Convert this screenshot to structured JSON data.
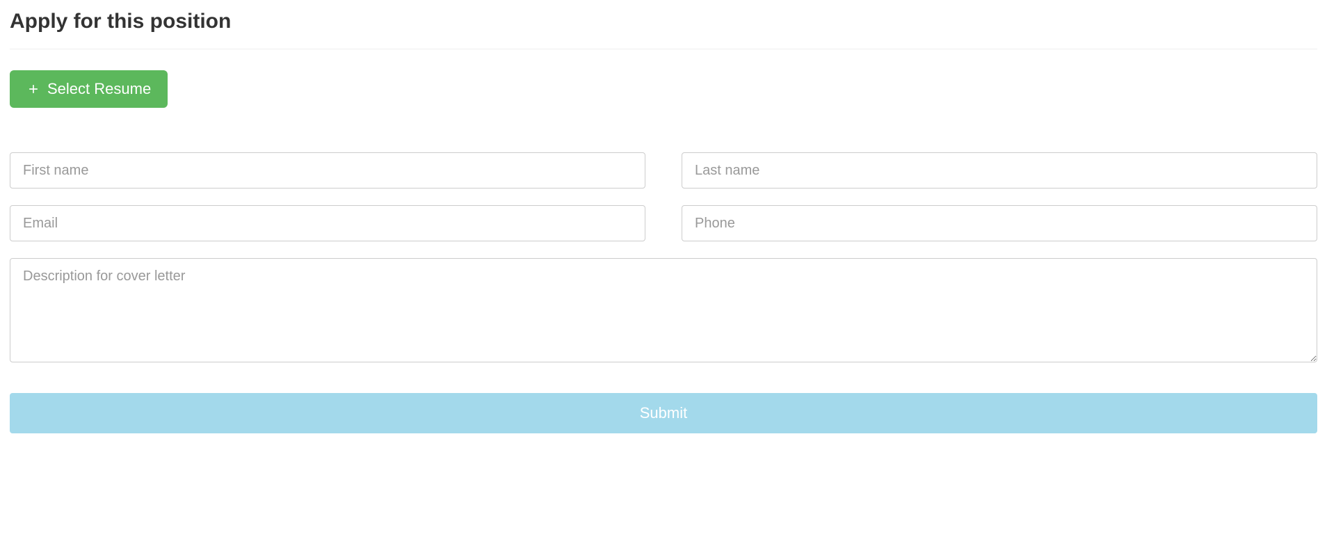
{
  "heading": "Apply for this position",
  "select_resume_label": "Select Resume",
  "fields": {
    "first_name": {
      "placeholder": "First name",
      "value": ""
    },
    "last_name": {
      "placeholder": "Last name",
      "value": ""
    },
    "email": {
      "placeholder": "Email",
      "value": ""
    },
    "phone": {
      "placeholder": "Phone",
      "value": ""
    },
    "cover_letter": {
      "placeholder": "Description for cover letter",
      "value": ""
    }
  },
  "submit_label": "Submit"
}
